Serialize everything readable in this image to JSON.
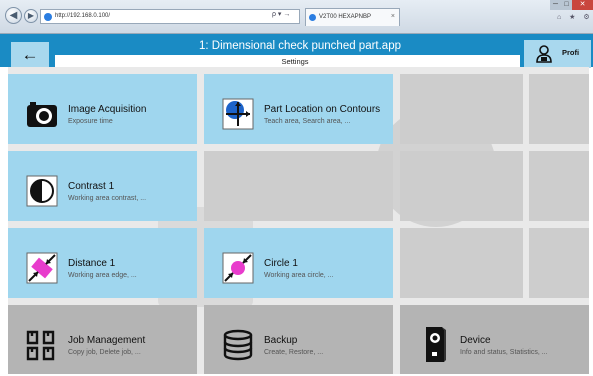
{
  "browser": {
    "address": "http://192.168.0.100/",
    "address_tools": "ρ ▾ →",
    "tab_title": "V2T00 HEXAPNBP",
    "tab_close": "×",
    "window_controls": {
      "minimize": "─",
      "maximize": "□",
      "close": "✕"
    },
    "toolbar_icons": "⌂ ★ ⚙"
  },
  "header": {
    "back_symbol": "←",
    "title": "1: Dimensional check punched part.app",
    "subtitle": "Settings",
    "profile_label": "Profi"
  },
  "tiles": [
    {
      "title": "Image Acquisition",
      "desc": "Exposure time",
      "icon": "camera-icon",
      "style": "blue"
    },
    {
      "title": "Part Location on Contours",
      "desc": "Teach area, Search area, ...",
      "icon": "part-location-icon",
      "style": "blue"
    },
    {
      "title": "Contrast 1",
      "desc": "Working area contrast, ...",
      "icon": "contrast-icon",
      "style": "blue"
    },
    {
      "title": "Distance 1",
      "desc": "Working area edge, ...",
      "icon": "distance-icon",
      "style": "blue"
    },
    {
      "title": "Circle 1",
      "desc": "Working area circle, ...",
      "icon": "circle-icon",
      "style": "blue"
    },
    {
      "title": "Job Management",
      "desc": "Copy job, Delete job, ...",
      "icon": "job-management-icon",
      "style": "grey"
    },
    {
      "title": "Backup",
      "desc": "Create, Restore, ...",
      "icon": "database-icon",
      "style": "grey"
    },
    {
      "title": "Device",
      "desc": "Info and status, Statistics, ...",
      "icon": "device-icon",
      "style": "grey"
    }
  ],
  "colors": {
    "header_blue": "#1a8bc4",
    "tile_blue": "#9fd6ee",
    "tile_grey": "#b4b4b4",
    "accent_magenta": "#e83ccc"
  }
}
